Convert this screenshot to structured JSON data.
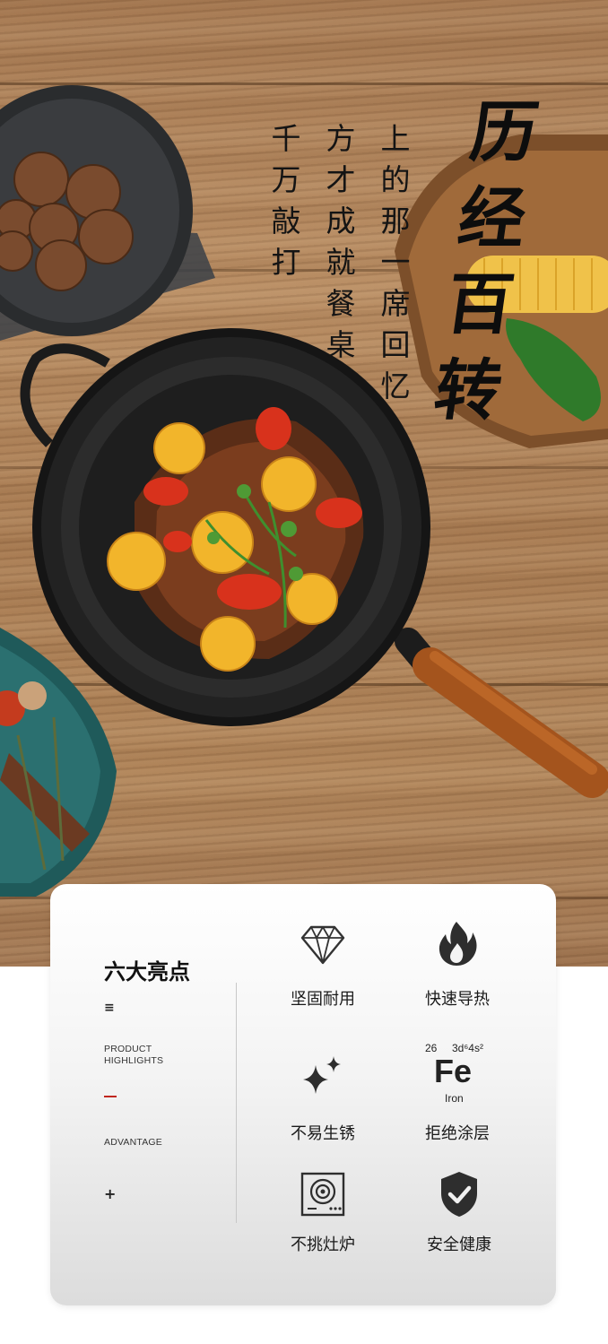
{
  "hero": {
    "poem_columns": [
      "上的那一席回忆",
      "方才成就餐桌",
      "千万敲打"
    ],
    "headline": "历经百转"
  },
  "highlights": {
    "title": "六大亮点",
    "mark_top": "≡",
    "label_product": "PRODUCT\nHIGHLIGHTS",
    "label_advantage": "ADVANTAGE",
    "mark_bottom": "+",
    "features": [
      {
        "label": "坚固耐用",
        "icon": "diamond-icon"
      },
      {
        "label": "快速导热",
        "icon": "flame-icon"
      },
      {
        "label": "不易生锈",
        "icon": "sparkle-icon"
      },
      {
        "label": "拒绝涂层",
        "icon": "iron-element-icon"
      },
      {
        "label": "不挑灶炉",
        "icon": "induction-cooker-icon"
      },
      {
        "label": "安全健康",
        "icon": "shield-check-icon"
      }
    ],
    "iron": {
      "number": "26",
      "config": "3d⁶4s²",
      "symbol": "Fe",
      "name": "Iron"
    }
  },
  "colors": {
    "accent": "#c0261e",
    "text": "#1a1a1a",
    "icon": "#333333"
  }
}
